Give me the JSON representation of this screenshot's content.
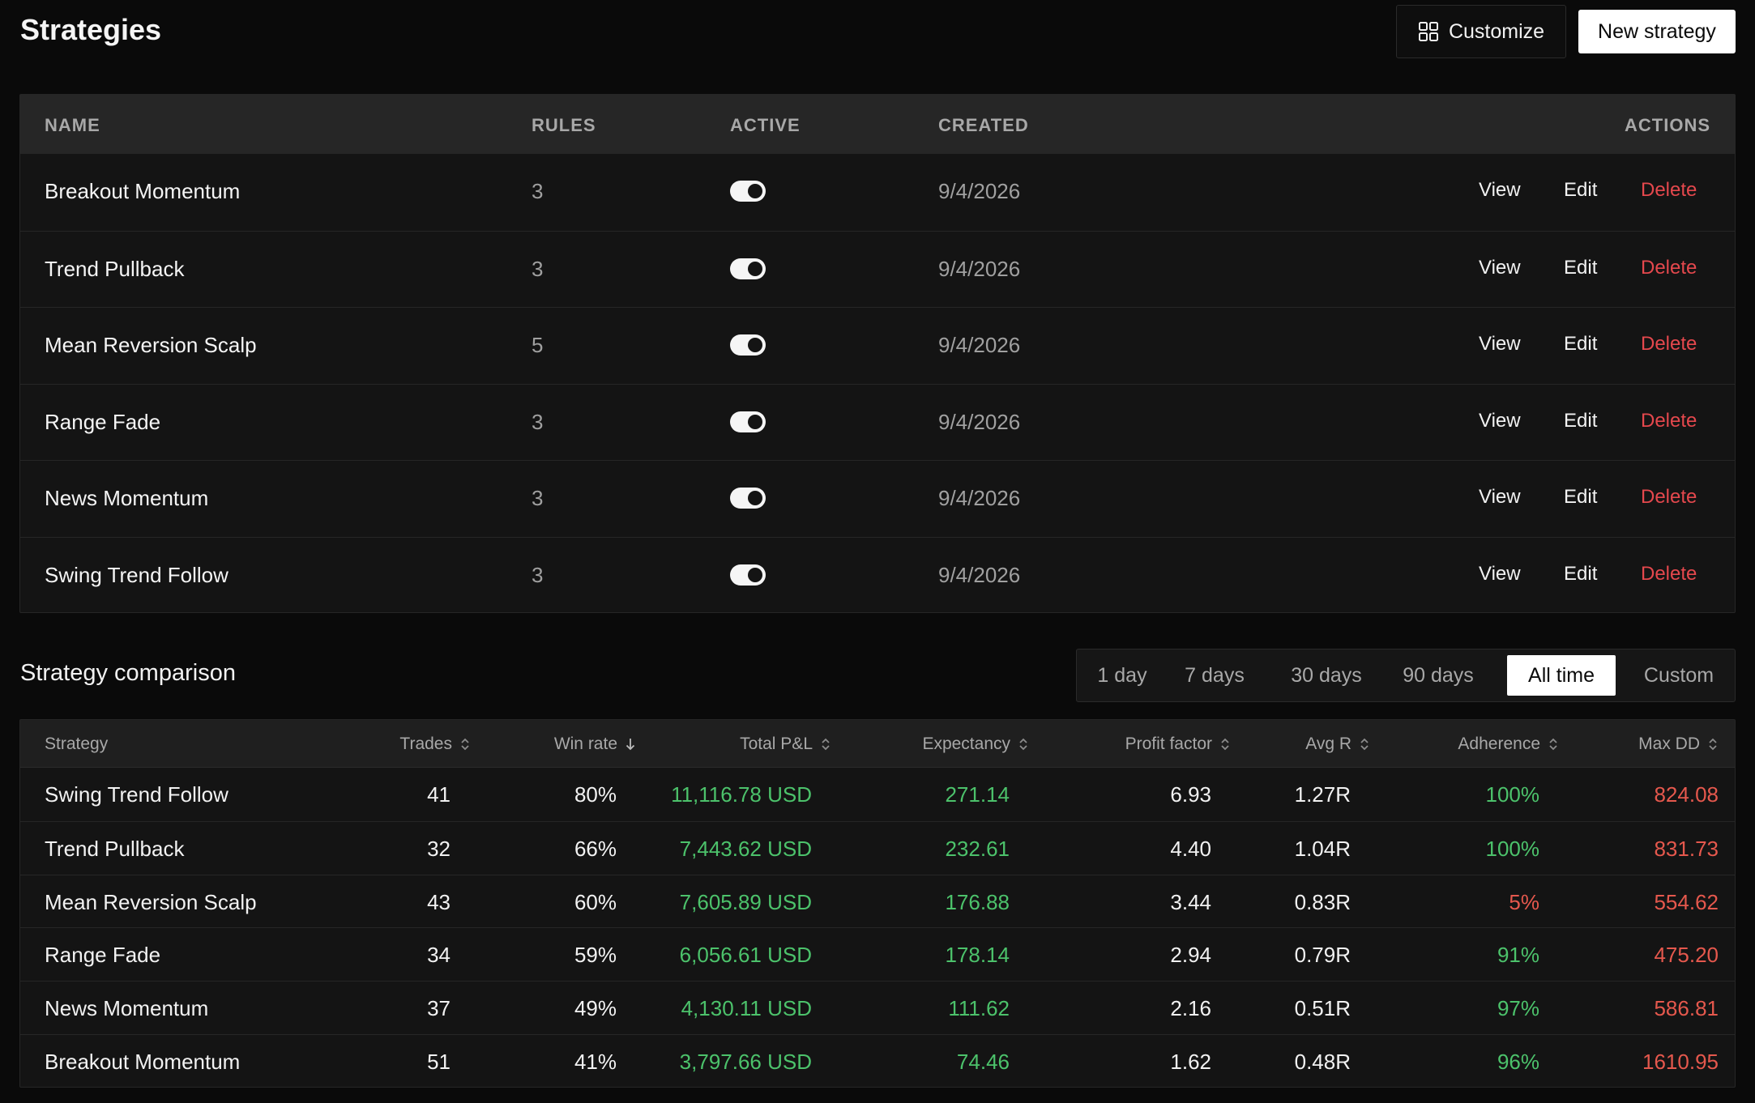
{
  "header": {
    "title": "Strategies",
    "customize_label": "Customize",
    "new_label": "New strategy"
  },
  "strategies": {
    "columns": [
      "NAME",
      "RULES",
      "ACTIVE",
      "CREATED",
      "ACTIONS"
    ],
    "actions": {
      "view": "View",
      "edit": "Edit",
      "delete": "Delete"
    },
    "rows": [
      {
        "name": "Breakout Momentum",
        "rules": "3",
        "active": true,
        "created": "9/4/2026"
      },
      {
        "name": "Trend Pullback",
        "rules": "3",
        "active": true,
        "created": "9/4/2026"
      },
      {
        "name": "Mean Reversion Scalp",
        "rules": "5",
        "active": true,
        "created": "9/4/2026"
      },
      {
        "name": "Range Fade",
        "rules": "3",
        "active": true,
        "created": "9/4/2026"
      },
      {
        "name": "News Momentum",
        "rules": "3",
        "active": true,
        "created": "9/4/2026"
      },
      {
        "name": "Swing Trend Follow",
        "rules": "3",
        "active": true,
        "created": "9/4/2026"
      }
    ]
  },
  "comparison": {
    "title": "Strategy comparison",
    "ranges": [
      "1 day",
      "7 days",
      "30 days",
      "90 days",
      "All time",
      "Custom"
    ],
    "selected_range": "All time",
    "columns": [
      "Strategy",
      "Trades",
      "Win rate",
      "Total P&L",
      "Expectancy",
      "Profit factor",
      "Avg R",
      "Adherence",
      "Max DD"
    ],
    "rows": [
      {
        "strategy": "Swing Trend Follow",
        "trades": "41",
        "win_rate": "80%",
        "pnl": "11,116.78 USD",
        "expectancy": "271.14",
        "profit_factor": "6.93",
        "avg_r": "1.27R",
        "adherence": "100%",
        "adherence_status": "green",
        "max_dd": "824.08"
      },
      {
        "strategy": "Trend Pullback",
        "trades": "32",
        "win_rate": "66%",
        "pnl": "7,443.62 USD",
        "expectancy": "232.61",
        "profit_factor": "4.40",
        "avg_r": "1.04R",
        "adherence": "100%",
        "adherence_status": "green",
        "max_dd": "831.73"
      },
      {
        "strategy": "Mean Reversion Scalp",
        "trades": "43",
        "win_rate": "60%",
        "pnl": "7,605.89 USD",
        "expectancy": "176.88",
        "profit_factor": "3.44",
        "avg_r": "0.83R",
        "adherence": "5%",
        "adherence_status": "red",
        "max_dd": "554.62"
      },
      {
        "strategy": "Range Fade",
        "trades": "34",
        "win_rate": "59%",
        "pnl": "6,056.61 USD",
        "expectancy": "178.14",
        "profit_factor": "2.94",
        "avg_r": "0.79R",
        "adherence": "91%",
        "adherence_status": "green",
        "max_dd": "475.20"
      },
      {
        "strategy": "News Momentum",
        "trades": "37",
        "win_rate": "49%",
        "pnl": "4,130.11 USD",
        "expectancy": "111.62",
        "profit_factor": "2.16",
        "avg_r": "0.51R",
        "adherence": "97%",
        "adherence_status": "green",
        "max_dd": "586.81"
      },
      {
        "strategy": "Breakout Momentum",
        "trades": "51",
        "win_rate": "41%",
        "pnl": "3,797.66 USD",
        "expectancy": "74.46",
        "profit_factor": "1.62",
        "avg_r": "0.48R",
        "adherence": "96%",
        "adherence_status": "green",
        "max_dd": "1610.95"
      }
    ]
  },
  "colors": {
    "positive": "#4cc26b",
    "negative": "#e5584d",
    "danger": "#e5484d"
  },
  "icons": {
    "customize": "grid-icon",
    "sort": "sort-updown-icon",
    "sorted": "arrow-down-icon"
  }
}
